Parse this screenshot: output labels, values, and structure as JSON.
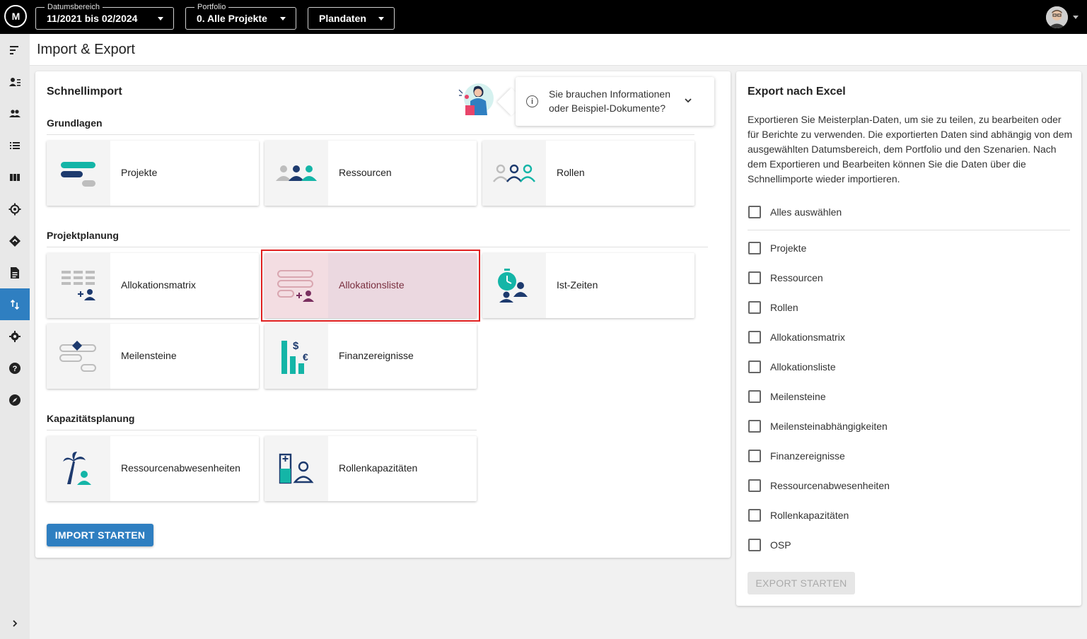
{
  "topbar": {
    "logo": "M",
    "date_range": {
      "label": "Datumsbereich",
      "value": "11/2021 bis 02/2024"
    },
    "portfolio": {
      "label": "Portfolio",
      "value": "0. Alle Projekte"
    },
    "data_mode": {
      "value": "Plandaten"
    }
  },
  "page": {
    "title": "Import & Export"
  },
  "schnellimport": {
    "title": "Schnellimport",
    "info_text_line1": "Sie brauchen Informationen",
    "info_text_line2": "oder Beispiel-Dokumente?",
    "sections": {
      "grundlagen": "Grundlagen",
      "projektplanung": "Projektplanung",
      "kapazitaetsplanung": "Kapazitätsplanung"
    },
    "tiles": {
      "projekte": "Projekte",
      "ressourcen": "Ressourcen",
      "rollen": "Rollen",
      "allokationsmatrix": "Allokationsmatrix",
      "allokationsliste": "Allokationsliste",
      "ist_zeiten": "Ist-Zeiten",
      "meilensteine": "Meilensteine",
      "finanzereignisse": "Finanzereignisse",
      "ressourcenabwesenheiten": "Ressourcenabwesenheiten",
      "rollenkapazitaeten": "Rollenkapazitäten"
    },
    "start_button": "IMPORT STARTEN"
  },
  "export": {
    "title": "Export nach Excel",
    "description": "Exportieren Sie Meisterplan-Daten, um sie zu teilen, zu bearbeiten oder für Berichte zu verwenden. Die exportierten Daten sind abhängig von dem ausgewählten Datumsbereich, dem Portfolio und den Szenarien. Nach dem Exportieren und Bearbeiten können Sie die Daten über die Schnellimporte wieder importieren.",
    "select_all": "Alles auswählen",
    "options": [
      "Projekte",
      "Ressourcen",
      "Rollen",
      "Allokationsmatrix",
      "Allokationsliste",
      "Meilensteine",
      "Meilensteinabhängigkeiten",
      "Finanzereignisse",
      "Ressourcenabwesenheiten",
      "Rollenkapazitäten",
      "OSP"
    ],
    "start_button": "EXPORT STARTEN"
  },
  "colors": {
    "accent": "#2f7fc1",
    "teal": "#14b5a7",
    "navy": "#1d3a6e",
    "plum": "#7a2f5f",
    "highlight": "#e02020"
  }
}
